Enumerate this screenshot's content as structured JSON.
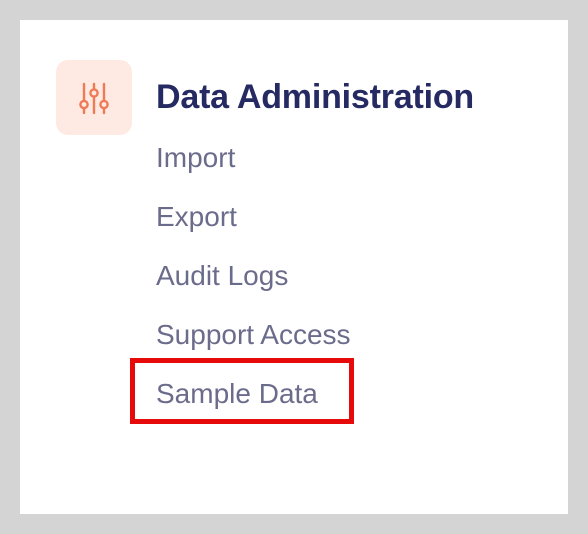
{
  "section": {
    "icon": "sliders-icon",
    "icon_color": "#f07a55",
    "icon_background": "#feeae2",
    "title": "Data Administration"
  },
  "menu": {
    "items": [
      {
        "label": "Import"
      },
      {
        "label": "Export"
      },
      {
        "label": "Audit Logs"
      },
      {
        "label": "Support Access"
      },
      {
        "label": "Sample Data",
        "highlighted": true
      }
    ]
  },
  "highlight": {
    "color": "#e60a0a",
    "target": "Sample Data"
  },
  "colors": {
    "title": "#262a63",
    "menu_text": "#6b6c8c",
    "frame": "#d4d4d4",
    "card": "#ffffff"
  }
}
